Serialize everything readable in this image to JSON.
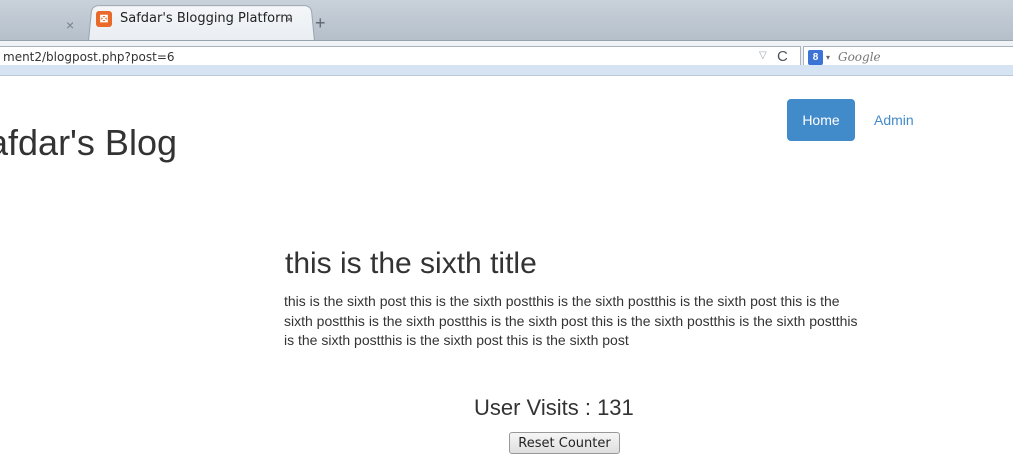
{
  "browser": {
    "prev_tab_close": "×",
    "active_tab": {
      "title": "Safdar's Blogging Platform",
      "close": "×",
      "favicon": "⊠"
    },
    "new_tab": "+",
    "url": "ment2/blogpost.php?post=6",
    "url_dropdown": "▽",
    "reload": "C",
    "search_engine_glyph": "8",
    "search_caret": "▾",
    "search_placeholder": "Google"
  },
  "site": {
    "title": "afdar's Blog"
  },
  "nav": {
    "home": "Home",
    "admin": "Admin"
  },
  "post": {
    "title": "this is the sixth title",
    "body": "this is the sixth post this is the sixth postthis is the sixth postthis is the sixth post this is the sixth postthis is the sixth postthis is the sixth post this is the sixth postthis is the sixth postthis is the sixth postthis is the sixth post this is the sixth post"
  },
  "counter": {
    "label": "User Visits : 131",
    "reset_label": "Reset Counter"
  },
  "colors": {
    "primary": "#428bca",
    "text": "#333333",
    "favicon": "#e8692a",
    "search_engine": "#3b73d6"
  }
}
